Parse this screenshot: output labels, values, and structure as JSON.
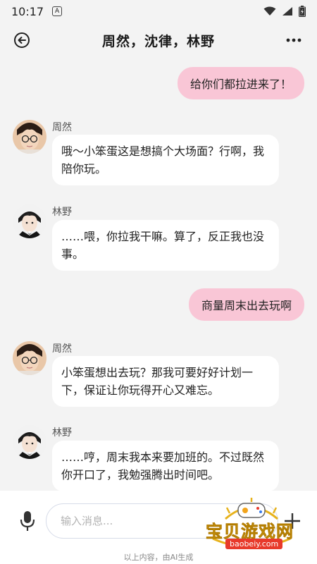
{
  "status_bar": {
    "time": "10:17",
    "notification_icon": "A"
  },
  "header": {
    "title": "周然，沈律，林野"
  },
  "messages": [
    {
      "type": "me",
      "text": "给你们都拉进来了！"
    },
    {
      "type": "other",
      "sender": "周然",
      "text": "哦～小笨蛋这是想搞个大场面？行啊，我陪你玩。"
    },
    {
      "type": "other",
      "sender": "林野",
      "text": "……喂，你拉我干嘛。算了，反正我也没事。"
    },
    {
      "type": "me",
      "text": "商量周末出去玩啊"
    },
    {
      "type": "other",
      "sender": "周然",
      "text": "小笨蛋想出去玩？那我可要好好计划一下，保证让你玩得开心又难忘。"
    },
    {
      "type": "other",
      "sender": "林野",
      "text": "……哼，周末我本来要加班的。不过既然你开口了，我勉强腾出时间吧。"
    }
  ],
  "input": {
    "placeholder": "输入消息...",
    "value": ""
  },
  "footer_note": "以上内容，由AI生成",
  "watermark": {
    "title": "宝贝游戏网",
    "url": "baobeiy.com"
  },
  "colors": {
    "my_bubble": "#f9c6d6",
    "other_bubble": "#ffffff",
    "background": "#f3f3f3",
    "watermark_gold": "#e7b21c",
    "watermark_red": "#e83a2b"
  },
  "icons": [
    "back-arrow-icon",
    "more-dots-icon",
    "microphone-icon",
    "plus-icon",
    "wifi-icon",
    "signal-icon",
    "battery-icon",
    "gamepad-icon"
  ]
}
